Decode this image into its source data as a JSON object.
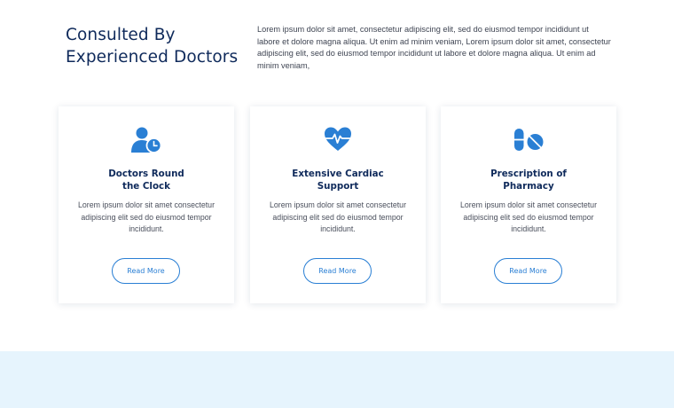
{
  "intro": {
    "title": "Consulted By Experienced Doctors",
    "text": "Lorem ipsum dolor sit amet, consectetur adipiscing elit, sed do eiusmod tempor incididunt ut labore et dolore magna aliqua. Ut enim ad minim veniam, Lorem ipsum dolor sit amet, consectetur adipiscing elit, sed do eiusmod tempor incididunt ut labore et dolore magna aliqua. Ut enim ad minim veniam,"
  },
  "cards": [
    {
      "icon": "doctor-clock-icon",
      "title": "Doctors Round\nthe Clock",
      "text": "Lorem ipsum dolor sit amet consectetur adipiscing elit sed do eiusmod tempor incididunt.",
      "button": "Read More"
    },
    {
      "icon": "heartbeat-icon",
      "title": "Extensive Cardiac\nSupport",
      "text": "Lorem ipsum dolor sit amet consectetur adipiscing elit sed do eiusmod tempor incididunt.",
      "button": "Read More"
    },
    {
      "icon": "pills-icon",
      "title": "Prescription of\nPharmacy",
      "text": "Lorem ipsum dolor sit amet consectetur adipiscing elit sed do eiusmod tempor incididunt.",
      "button": "Read More"
    }
  ],
  "colors": {
    "heading": "#0f2a5b",
    "accent": "#2a7fd4",
    "band": "#e6f4fd"
  }
}
